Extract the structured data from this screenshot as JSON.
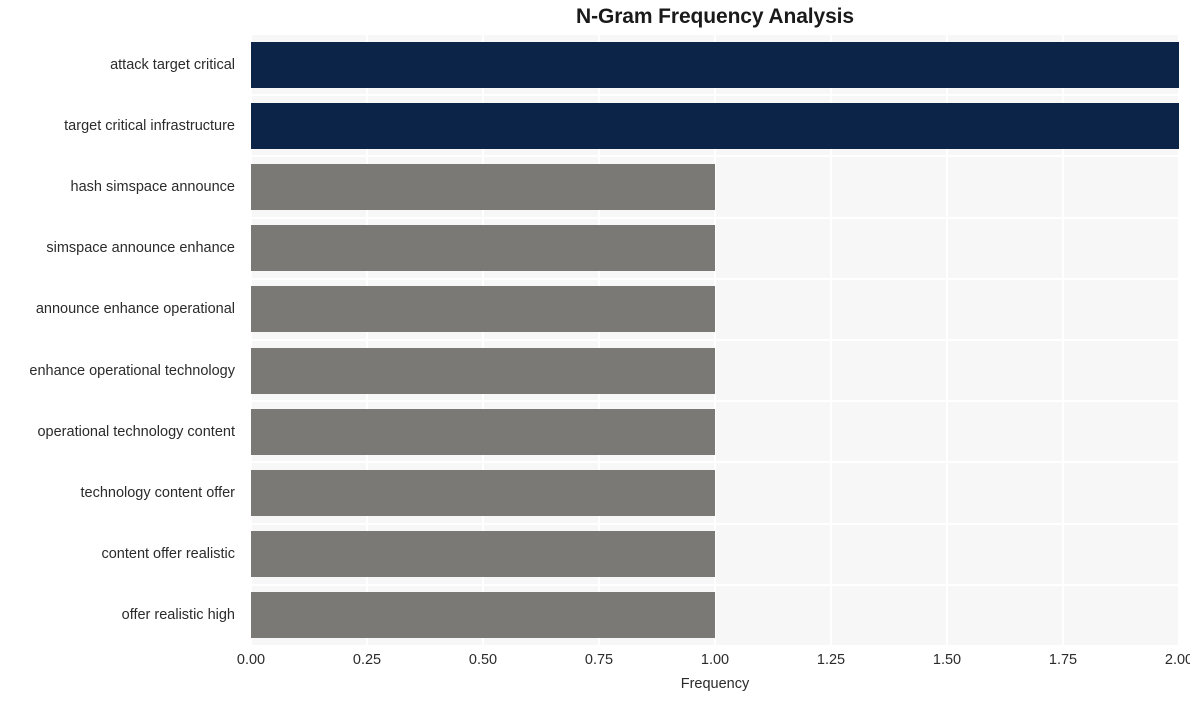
{
  "chart_data": {
    "type": "bar",
    "orientation": "horizontal",
    "title": "N-Gram Frequency Analysis",
    "xlabel": "Frequency",
    "ylabel": "",
    "categories": [
      "attack target critical",
      "target critical infrastructure",
      "hash simspace announce",
      "simspace announce enhance",
      "announce enhance operational",
      "enhance operational technology",
      "operational technology content",
      "technology content offer",
      "content offer realistic",
      "offer realistic high"
    ],
    "values": [
      2,
      2,
      1,
      1,
      1,
      1,
      1,
      1,
      1,
      1
    ],
    "bar_colors": [
      "#0b2447",
      "#0b2447",
      "#7a7976",
      "#7a7976",
      "#7a7976",
      "#7a7976",
      "#7a7976",
      "#7a7976",
      "#7a7976",
      "#7a7976"
    ],
    "xlim": [
      0,
      2
    ],
    "xticks": [
      0,
      0.25,
      0.5,
      0.75,
      1,
      1.25,
      1.5,
      1.75,
      2
    ],
    "xtick_labels": [
      "0.00",
      "0.25",
      "0.50",
      "0.75",
      "1.00",
      "1.25",
      "1.50",
      "1.75",
      "2.00"
    ],
    "grid": true,
    "grid_color": "#ffffff",
    "plot_background": "#f7f7f8",
    "figure_background": "#ffffff",
    "legend": null,
    "highlight_color": "#0b2447",
    "base_color": "#7a7976"
  }
}
